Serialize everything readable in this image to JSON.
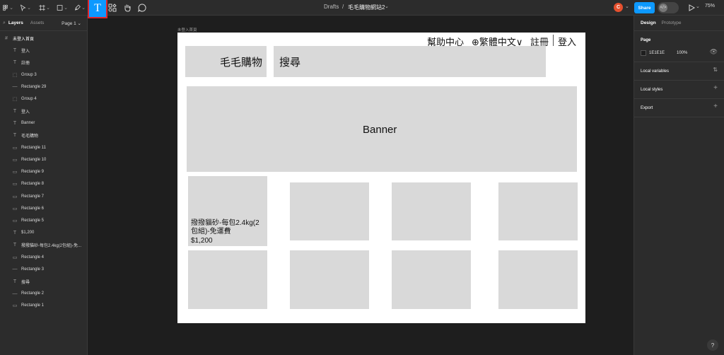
{
  "toolbar": {
    "breadcrumb_drafts": "Drafts",
    "breadcrumb_sep": "/",
    "file_name": "毛毛購物網站2",
    "avatar_initial": "C",
    "share_label": "Share",
    "zoom": "75%",
    "icons": [
      "main-menu-icon",
      "move-tool-icon",
      "frame-tool-icon",
      "shape-tool-icon",
      "pen-tool-icon",
      "text-tool-icon",
      "resources-icon",
      "hand-tool-icon",
      "comment-icon",
      "dev-mode-icon",
      "present-icon"
    ],
    "text_tool_glyph": "T",
    "active_tool": "text-tool",
    "accent": "#0d99ff"
  },
  "left_panel": {
    "tabs": [
      "Layers",
      "Assets"
    ],
    "page_select": "Page 1",
    "layers": [
      {
        "name": "未登入首頁",
        "type": "frame"
      },
      {
        "name": "登入",
        "type": "text"
      },
      {
        "name": "註冊",
        "type": "text"
      },
      {
        "name": "Group 3",
        "type": "group"
      },
      {
        "name": "Rectangle 29",
        "type": "line"
      },
      {
        "name": "Group 4",
        "type": "group"
      },
      {
        "name": "登入",
        "type": "text"
      },
      {
        "name": "Banner",
        "type": "text"
      },
      {
        "name": "毛毛購物",
        "type": "text"
      },
      {
        "name": "Rectangle 11",
        "type": "rect"
      },
      {
        "name": "Rectangle 10",
        "type": "rect"
      },
      {
        "name": "Rectangle 9",
        "type": "rect"
      },
      {
        "name": "Rectangle 8",
        "type": "rect"
      },
      {
        "name": "Rectangle 7",
        "type": "rect"
      },
      {
        "name": "Rectangle 6",
        "type": "rect"
      },
      {
        "name": "Rectangle 5",
        "type": "rect"
      },
      {
        "name": "$1,200",
        "type": "text"
      },
      {
        "name": "撥撥貓砂-每包2.4kg(2包組)-免...",
        "type": "text"
      },
      {
        "name": "Rectangle 4",
        "type": "rect"
      },
      {
        "name": "Rectangle 3",
        "type": "line"
      },
      {
        "name": "搜尋",
        "type": "text"
      },
      {
        "name": "Rectangle 2",
        "type": "line"
      },
      {
        "name": "Rectangle 1",
        "type": "rect"
      }
    ]
  },
  "right_panel": {
    "tabs": [
      "Design",
      "Prototype"
    ],
    "page_title": "Page",
    "page_color_hex": "1E1E1E",
    "page_opacity": "100%",
    "sections": [
      "Local variables",
      "Local styles",
      "Export"
    ],
    "help": "?"
  },
  "canvas": {
    "frame_label": "未登入首頁",
    "nav_help": "幫助中心",
    "nav_language": "⊕繁體中文∨",
    "nav_register": "註冊",
    "nav_login": "登入",
    "logo": "毛毛購物",
    "search": "搜尋",
    "banner": "Banner",
    "product_name": "撥撥貓砂-每包2.4kg(2包組)-免運費",
    "product_name_line1": "撥撥貓砂-每包2.4kg(2",
    "product_name_line2": "包組)-免運費",
    "product_price": "$1,200",
    "placeholder_color": "#d9d9d9"
  }
}
